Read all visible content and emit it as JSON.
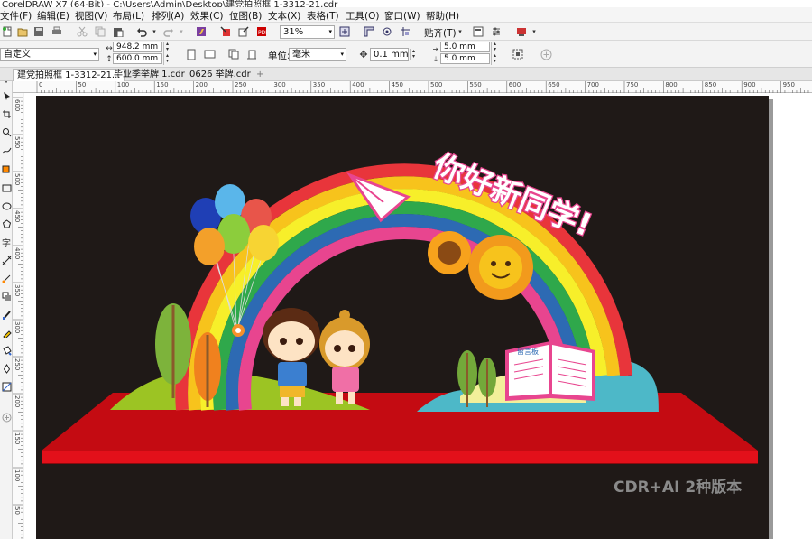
{
  "window": {
    "title": "CorelDRAW X7 (64-Bit) - C:\\Users\\Admin\\Desktop\\建党拍照框 1-3312-21.cdr"
  },
  "menu": {
    "items": [
      {
        "label": "文件(F)"
      },
      {
        "label": "编辑(E)"
      },
      {
        "label": "视图(V)"
      },
      {
        "label": "布局(L)"
      },
      {
        "label": "排列(A)"
      },
      {
        "label": "效果(C)"
      },
      {
        "label": "位图(B)"
      },
      {
        "label": "文本(X)"
      },
      {
        "label": "表格(T)"
      },
      {
        "label": "工具(O)"
      },
      {
        "label": "窗口(W)"
      },
      {
        "label": "帮助(H)"
      }
    ]
  },
  "toolbar": {
    "zoom": "31%",
    "snap": "贴齐(T)"
  },
  "propertybar": {
    "page_preset": "自定义",
    "width": "948.2 mm",
    "height": "600.0 mm",
    "units_label": "单位:",
    "units_value": "毫米",
    "nudge": "0.1 mm",
    "dup_x": "5.0 mm",
    "dup_y": "5.0 mm"
  },
  "tabs": [
    {
      "label": "建党拍照框 1-3312-21..."
    },
    {
      "label": "毕业季举牌 1.cdr"
    },
    {
      "label": "0626 举牌.cdr"
    }
  ],
  "ruler": {
    "h_marks": [
      "0",
      "50",
      "100",
      "150",
      "200",
      "250",
      "300",
      "350",
      "400",
      "450",
      "500",
      "550",
      "600",
      "650",
      "700",
      "750",
      "800",
      "850",
      "900",
      "950"
    ],
    "v_marks": [
      "600",
      "550",
      "500",
      "450",
      "400",
      "350",
      "300",
      "250",
      "200",
      "150",
      "100",
      "50"
    ]
  },
  "artwork": {
    "headline": "你好新同学!",
    "book_label": "留言板",
    "watermark": "CDR+AI 2种版本"
  },
  "colors": {
    "page_bg": "#1f1917",
    "platform_red": "#d10a14",
    "rainbow": [
      "#e8353b",
      "#f7c31c",
      "#f7ef2a",
      "#2fa84b",
      "#2d6ab3",
      "#e8458f"
    ]
  }
}
